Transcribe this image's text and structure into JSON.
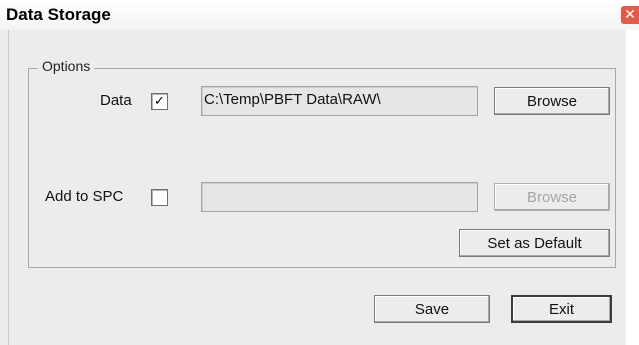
{
  "window": {
    "title": "Data Storage",
    "close_glyph": "✕"
  },
  "options": {
    "group_label": "Options",
    "data": {
      "label": "Data",
      "checked": true,
      "check_glyph": "✓",
      "path": "C:\\Temp\\PBFT Data\\RAW\\",
      "browse_label": "Browse"
    },
    "spc": {
      "label": "Add to SPC",
      "checked": false,
      "path": "",
      "browse_label": "Browse"
    },
    "set_default_label": "Set as Default"
  },
  "footer": {
    "save_label": "Save",
    "exit_label": "Exit"
  },
  "colors": {
    "close_button": "#e25b4a",
    "dialog_bg": "#ececec"
  }
}
